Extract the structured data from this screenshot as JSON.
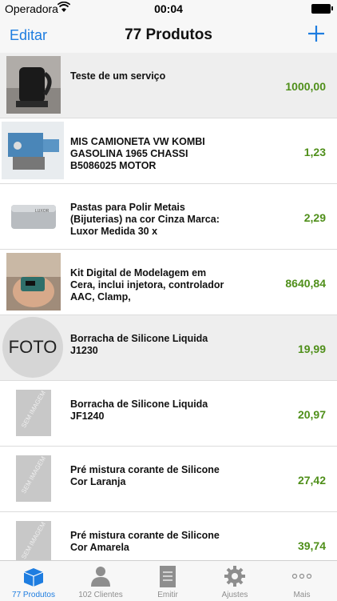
{
  "status": {
    "carrier": "Operadora",
    "time": "00:04"
  },
  "nav": {
    "edit_label": "Editar",
    "title": "77 Produtos"
  },
  "products": [
    {
      "name": "Teste de um serviço",
      "price": "1000,00",
      "thumb": "kettle"
    },
    {
      "name": "MIS CAMIONETA VW KOMBI GASOLINA 1965 CHASSI B5086025 MOTOR",
      "price": "1,23",
      "thumb": "machine"
    },
    {
      "name": "Pastas para Polir Metais (Bijuterias) na cor Cinza Marca: Luxor Medida 30 x",
      "price": "2,29",
      "thumb": "paste"
    },
    {
      "name": "Kit Digital de Modelagem em Cera, inclui injetora, controlador AAC, Clamp,",
      "price": "8640,84",
      "thumb": "hand-kit"
    },
    {
      "name": "Borracha de Silicone Liquida J1230",
      "price": "19,99",
      "thumb": "foto",
      "thumb_text": "FOTO"
    },
    {
      "name": "Borracha de Silicone Liquida JF1240",
      "price": "20,97",
      "thumb": "no-image",
      "thumb_text": "SEM IMAGEM"
    },
    {
      "name": "Pré mistura corante de Silicone Cor Laranja",
      "price": "27,42",
      "thumb": "no-image",
      "thumb_text": "SEM IMAGEM"
    },
    {
      "name": "Pré mistura corante de Silicone Cor Amarela",
      "price": "39,74",
      "thumb": "no-image",
      "thumb_text": "SEM IMAGEM"
    }
  ],
  "tabs": [
    {
      "label": "77 Produtos",
      "icon": "box-icon",
      "active": true
    },
    {
      "label": "102 Clientes",
      "icon": "person-icon",
      "active": false
    },
    {
      "label": "Emitir",
      "icon": "document-icon",
      "active": false
    },
    {
      "label": "Ajustes",
      "icon": "gear-icon",
      "active": false
    },
    {
      "label": "Mais",
      "icon": "more-icon",
      "active": false
    }
  ],
  "colors": {
    "accent": "#1e7de0",
    "price": "#4f8f1a"
  }
}
